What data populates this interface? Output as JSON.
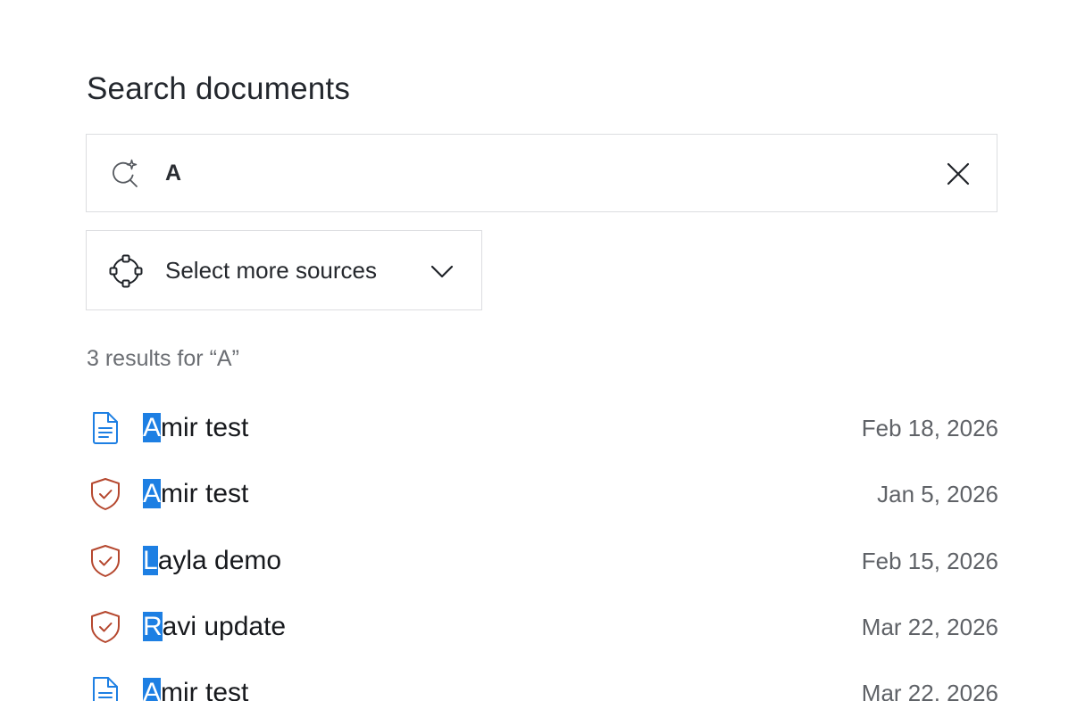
{
  "page_title": "Search documents",
  "search": {
    "value": "A",
    "placeholder": ""
  },
  "sources": {
    "label": "Select more sources"
  },
  "results_summary": {
    "prefix": "3 results for",
    "query": "“A”"
  },
  "results": [
    {
      "icon": "document-icon",
      "highlight": "A",
      "rest": "mir test",
      "date": "Feb 18, 2026"
    },
    {
      "icon": "shield-check-icon",
      "highlight": "A",
      "rest": "mir test",
      "date": "Jan 5, 2026"
    },
    {
      "icon": "shield-check-icon",
      "highlight": "L",
      "rest": "ayla demo",
      "date": "Feb 15, 2026"
    },
    {
      "icon": "shield-check-icon",
      "highlight": "R",
      "rest": "avi update",
      "date": "Mar 22, 2026"
    },
    {
      "icon": "document-icon",
      "highlight": "A",
      "rest": "mir test",
      "date": "Mar 22, 2026"
    }
  ],
  "colors": {
    "highlight": "#1d7fe3",
    "document_icon": "#1d7fe3",
    "shield_icon": "#b5472e",
    "border": "#dcdde0"
  }
}
